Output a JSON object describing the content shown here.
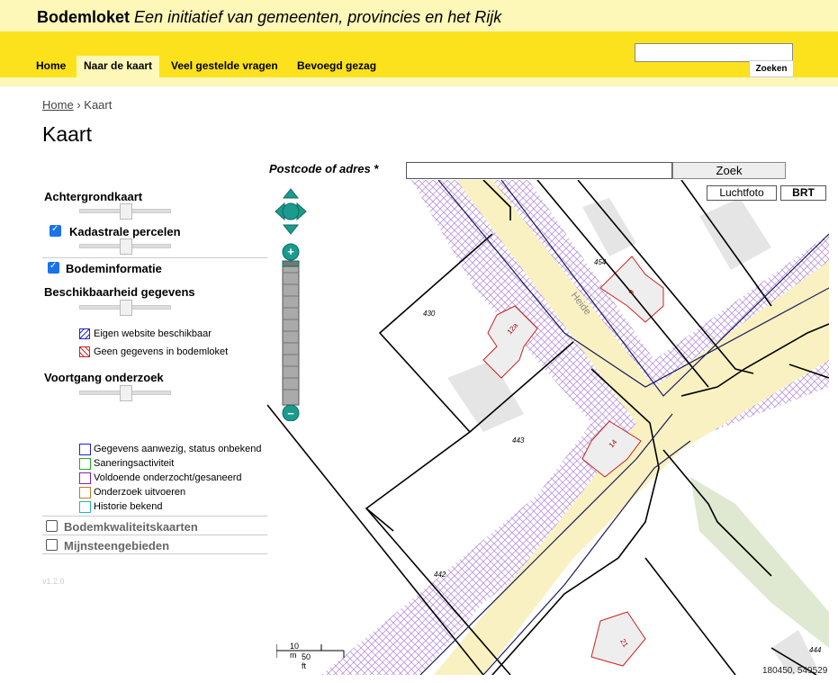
{
  "header": {
    "brand": "Bodemloket",
    "tagline": "Een initiatief van gemeenten, provincies en het Rijk"
  },
  "nav": {
    "items": [
      "Home",
      "Naar de kaart",
      "Veel gestelde vragen",
      "Bevoegd gezag"
    ],
    "active": "Naar de kaart"
  },
  "search": {
    "button": "Zoeken",
    "value": ""
  },
  "breadcrumb": {
    "home": "Home",
    "separator": "›",
    "current": "Kaart"
  },
  "page_title": "Kaart",
  "address": {
    "label": "Postcode of adres *",
    "value": "",
    "button": "Zoek"
  },
  "basemap": {
    "aerial": "Luchtfoto",
    "brt": "BRT"
  },
  "panel": {
    "achtergrondkaart": "Achtergrondkaart",
    "kadastrale": "Kadastrale percelen",
    "bodeminformatie": "Bodeminformatie",
    "beschikbaarheid": "Beschikbaarheid gegevens",
    "legend1": [
      {
        "label": "Eigen website beschikbaar",
        "color": "#2222cc"
      },
      {
        "label": "Geen gegevens in bodemloket",
        "color": "#cc2222"
      }
    ],
    "voortgang": "Voortgang onderzoek",
    "legend2": [
      {
        "label": "Gegevens aanwezig, status onbekend",
        "color": "#1f1fd6"
      },
      {
        "label": "Saneringsactiviteit",
        "color": "#22aa22"
      },
      {
        "label": "Voldoende onderzocht/gesaneerd",
        "color": "#8b22b5"
      },
      {
        "label": "Onderzoek uitvoeren",
        "color": "#c77a1d"
      },
      {
        "label": "Historie bekend",
        "color": "#26b5b5"
      }
    ],
    "bodemkwaliteitskaarten": "Bodemkwaliteitskaarten",
    "mijnsteengebieden": "Mijnsteengebieden",
    "version": "v1.2.0"
  },
  "map": {
    "street": "Heide",
    "parcels": [
      "454",
      "430",
      "443",
      "442",
      "444"
    ],
    "houses": [
      "9",
      "12a",
      "14",
      "21"
    ],
    "scale_m": "10 m",
    "scale_ft": "50 ft",
    "coords": "180450, 549529"
  }
}
